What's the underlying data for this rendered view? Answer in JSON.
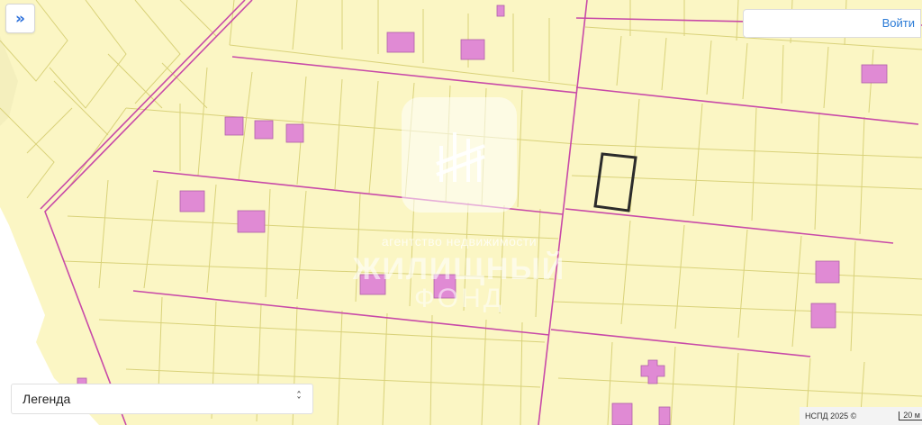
{
  "map": {
    "background": "#fbf6c4",
    "parcel_line_color": "#d9d27a",
    "road_line_color": "#c84aa8",
    "building_color": "#e08ad4",
    "selected_parcel_color": "#2b2b2b"
  },
  "controls": {
    "expand_icon": "double-chevron-right-icon",
    "expand_glyph": "»",
    "login_label": "Войти",
    "legend_label": "Легенда",
    "legend_icon": "chevron-up-down-icon"
  },
  "attribution": {
    "text": "НСПД 2025 ©",
    "scale_label": "20 м"
  },
  "watermark": {
    "subtitle": "агентство недвижимости",
    "title_line1": "ЖИЛИЩНЫЙ",
    "title_line2": "ФОНД"
  }
}
